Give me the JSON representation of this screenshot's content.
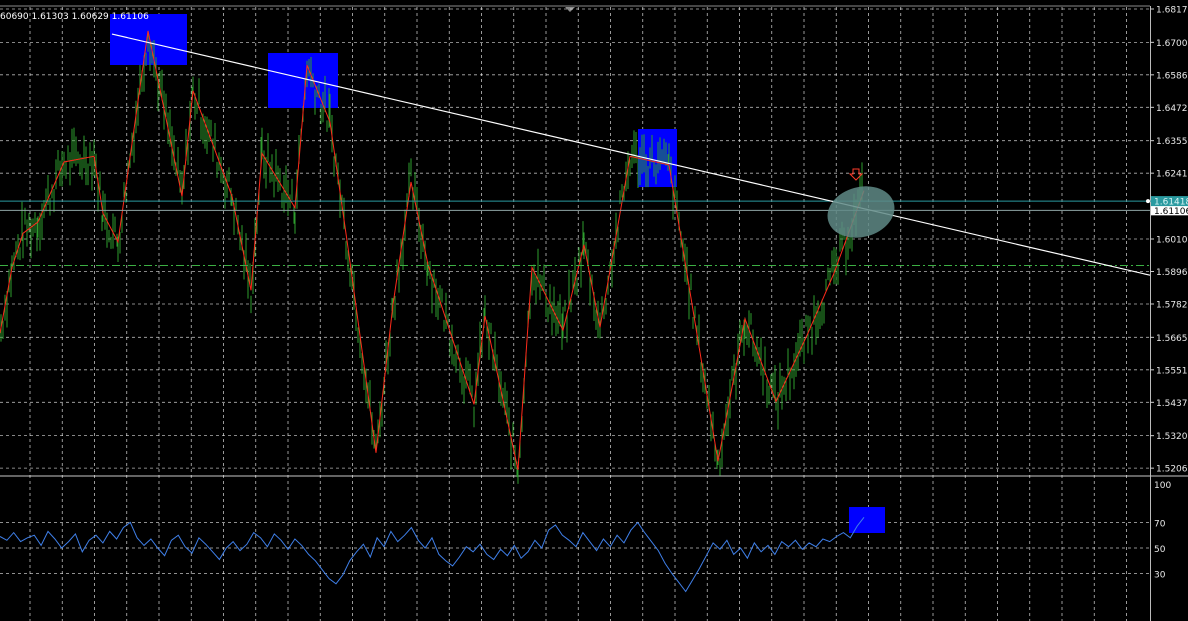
{
  "header": {
    "ohlc_text": "60690 1.61303 1.60629 1.61106"
  },
  "colors": {
    "background": "#000000",
    "grid": "#ffffff",
    "bar": "#2e9e2e",
    "zigzag": "#ff2a1a",
    "trendline": "#ffffff",
    "level_line": "#2a9aa0",
    "dash_level": "#3cb043",
    "highlight": "#0000ff",
    "ellipse": "#5f8a86",
    "rsi": "#3f7fe8",
    "tag_bg": "#ffffff"
  },
  "chart_data": [
    {
      "type": "ohlc",
      "panel": "price",
      "ylim": [
        1.5196,
        1.6817
      ],
      "price_ticks": [
        "1.68170",
        "1.67000",
        "1.65860",
        "1.64720",
        "1.63550",
        "1.62410",
        "1.61106",
        "1.60100",
        "1.58960",
        "1.57820",
        "1.56650",
        "1.55510",
        "1.54370",
        "1.53200",
        "1.52060"
      ],
      "current_price_label": "1.61106",
      "level_label": "1.61418",
      "level_price": 1.6143,
      "dashed_level_price": 1.5917,
      "zigzag_prices": [
        1.568,
        1.591,
        1.603,
        1.607,
        1.628,
        1.63,
        1.61,
        1.6,
        1.674,
        1.616,
        1.653,
        1.616,
        1.583,
        1.631,
        1.612,
        1.662,
        1.642,
        1.598,
        1.526,
        1.578,
        1.621,
        1.592,
        1.543,
        1.574,
        1.52,
        1.591,
        1.569,
        1.599,
        1.57,
        1.63,
        1.627,
        1.523,
        1.573,
        1.544,
        1.568,
        1.589,
        1.618
      ],
      "trendline_start": 1.6729,
      "trendline_end": 1.5883,
      "markers": [
        "down-arrow-icon"
      ]
    },
    {
      "type": "line",
      "panel": "rsi",
      "ylim": [
        0,
        100
      ],
      "ticks": [
        100,
        70,
        50,
        30
      ],
      "tick_labels": [
        "100",
        "70",
        "50",
        "30"
      ],
      "levels": [
        70,
        50,
        30
      ],
      "values": [
        59,
        56,
        62,
        55,
        58,
        60,
        52,
        63,
        57,
        50,
        55,
        61,
        47,
        56,
        60,
        54,
        63,
        57,
        66,
        70,
        58,
        52,
        57,
        50,
        44,
        56,
        60,
        51,
        46,
        58,
        53,
        47,
        41,
        50,
        55,
        48,
        53,
        62,
        58,
        51,
        61,
        56,
        49,
        57,
        52,
        45,
        40,
        33,
        26,
        22,
        29,
        40,
        47,
        53,
        43,
        58,
        51,
        63,
        55,
        60,
        66,
        56,
        50,
        58,
        45,
        40,
        36,
        43,
        51,
        47,
        53,
        45,
        41,
        49,
        44,
        52,
        42,
        47,
        56,
        50,
        64,
        68,
        60,
        56,
        51,
        62,
        55,
        48,
        57,
        51,
        60,
        54,
        64,
        70,
        62,
        55,
        48,
        38,
        30,
        23,
        16,
        25,
        34,
        44,
        54,
        49,
        56,
        45,
        50,
        42,
        54,
        47,
        52,
        45,
        55,
        51,
        56,
        49,
        54,
        51,
        57,
        55,
        59,
        62,
        58,
        67,
        74
      ]
    }
  ]
}
